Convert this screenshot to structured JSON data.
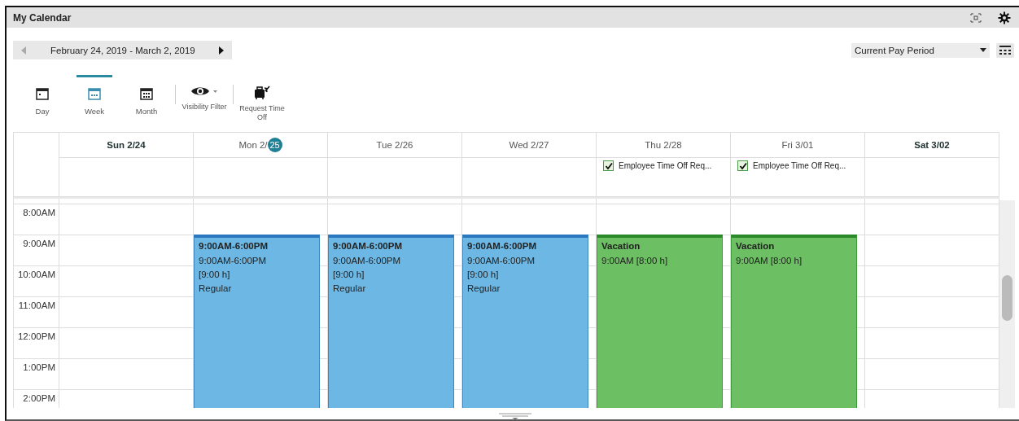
{
  "window": {
    "title": "My Calendar"
  },
  "date_range": {
    "label": "February 24, 2019 - March 2, 2019",
    "prev_disabled": true
  },
  "period_select": {
    "value": "Current Pay Period"
  },
  "views": [
    {
      "label": "Day",
      "kind": "day",
      "selected": false
    },
    {
      "label": "Week",
      "kind": "week",
      "selected": true
    },
    {
      "label": "Month",
      "kind": "month",
      "selected": false
    }
  ],
  "tools": [
    {
      "label": "Visibility Filter",
      "kind": "visibility"
    },
    {
      "label": "Request Time Off",
      "kind": "time_off"
    }
  ],
  "days": [
    {
      "label": "Sun 2/24",
      "weekend": true
    },
    {
      "label": "Mon 2/",
      "badge": "25",
      "weekend": false,
      "events": [
        {
          "kind": "shift",
          "title": "9:00AM-6:00PM",
          "lines": [
            "9:00AM-6:00PM",
            "[9:00 h]",
            "Regular"
          ]
        }
      ]
    },
    {
      "label": "Tue 2/26",
      "weekend": false,
      "events": [
        {
          "kind": "shift",
          "title": "9:00AM-6:00PM",
          "lines": [
            "9:00AM-6:00PM",
            "[9:00 h]",
            "Regular"
          ]
        }
      ]
    },
    {
      "label": "Wed 2/27",
      "weekend": false,
      "events": [
        {
          "kind": "shift",
          "title": "9:00AM-6:00PM",
          "lines": [
            "9:00AM-6:00PM",
            "[9:00 h]",
            "Regular"
          ]
        }
      ]
    },
    {
      "label": "Thu 2/28",
      "weekend": false,
      "all_day": [
        {
          "label": "Employee Time Off Req...",
          "checked": true
        }
      ],
      "events": [
        {
          "kind": "time_off",
          "title": "Vacation",
          "lines": [
            "9:00AM [8:00 h]"
          ]
        }
      ]
    },
    {
      "label": "Fri 3/01",
      "weekend": false,
      "all_day": [
        {
          "label": "Employee Time Off Req...",
          "checked": true
        }
      ],
      "events": [
        {
          "kind": "time_off",
          "title": "Vacation",
          "lines": [
            "9:00AM [8:00 h]"
          ]
        }
      ]
    },
    {
      "label": "Sat 3/02",
      "weekend": true
    }
  ],
  "times": [
    "8:00AM",
    "9:00AM",
    "10:00AM",
    "11:00AM",
    "12:00PM",
    "1:00PM",
    "2:00PM"
  ]
}
